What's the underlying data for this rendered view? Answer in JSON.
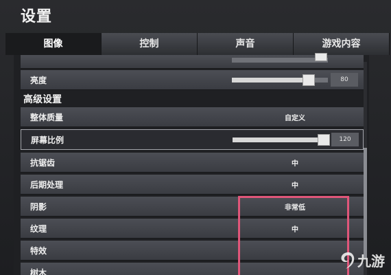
{
  "title": "设置",
  "tabs": [
    {
      "label": "图像",
      "active": true
    },
    {
      "label": "控制",
      "active": false
    },
    {
      "label": "声音",
      "active": false
    },
    {
      "label": "游戏内容",
      "active": false
    }
  ],
  "brightness": {
    "label": "亮度",
    "value": "80",
    "level": 0.8
  },
  "section_title": "高级设置",
  "rows": {
    "quality": {
      "label": "整体质量",
      "value": "自定义"
    },
    "screen_ratio": {
      "label": "屏幕比例",
      "value": "120",
      "level": 0.95
    },
    "antialias": {
      "label": "抗锯齿",
      "value": "中"
    },
    "post": {
      "label": "后期处理",
      "value": "中"
    },
    "shadow": {
      "label": "阴影",
      "value": "非常低"
    },
    "texture": {
      "label": "纹理",
      "value": "中"
    },
    "effects": {
      "label": "特效",
      "value": ""
    },
    "trees": {
      "label": "树木",
      "value": ""
    }
  },
  "watermark": {
    "text": "九游",
    "icon": "jiuyou-logo-icon"
  },
  "colors": {
    "highlight": "#e0567a",
    "accent": "#ffffff"
  }
}
